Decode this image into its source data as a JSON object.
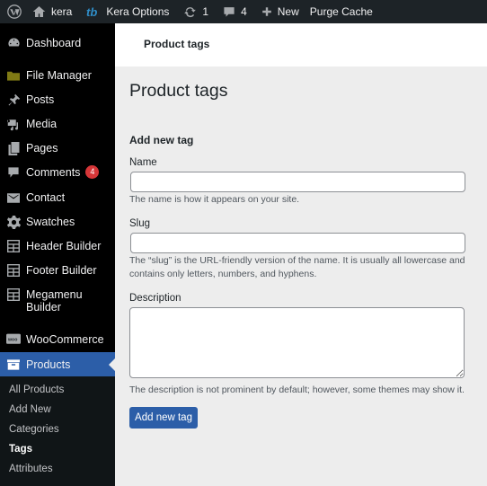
{
  "admin_bar": {
    "site_name": "kera",
    "theme_options": "Kera Options",
    "updates_count": "1",
    "comments_count": "4",
    "new_label": "New",
    "purge_cache": "Purge Cache"
  },
  "sidebar": {
    "items": [
      {
        "label": "Dashboard",
        "icon": "dashboard-icon"
      },
      {
        "label": "File Manager",
        "icon": "folder-icon"
      },
      {
        "label": "Posts",
        "icon": "pin-icon"
      },
      {
        "label": "Media",
        "icon": "media-icon"
      },
      {
        "label": "Pages",
        "icon": "pages-icon"
      },
      {
        "label": "Comments",
        "icon": "comment-icon",
        "badge": "4"
      },
      {
        "label": "Contact",
        "icon": "mail-icon"
      },
      {
        "label": "Swatches",
        "icon": "gear-icon"
      },
      {
        "label": "Header Builder",
        "icon": "builder-icon"
      },
      {
        "label": "Footer Builder",
        "icon": "builder-icon"
      },
      {
        "label": "Megamenu Builder",
        "icon": "builder-icon"
      },
      {
        "label": "WooCommerce",
        "icon": "woo-icon"
      },
      {
        "label": "Products",
        "icon": "archive-icon",
        "active": true
      }
    ],
    "submenu": [
      {
        "label": "All Products"
      },
      {
        "label": "Add New"
      },
      {
        "label": "Categories"
      },
      {
        "label": "Tags",
        "current": true
      },
      {
        "label": "Attributes"
      }
    ]
  },
  "header": {
    "title": "Product tags"
  },
  "main": {
    "page_title": "Product tags",
    "section_title": "Add new tag",
    "name_label": "Name",
    "name_value": "",
    "name_help": "The name is how it appears on your site.",
    "slug_label": "Slug",
    "slug_value": "",
    "slug_help": "The “slug” is the URL-friendly version of the name. It is usually all lowercase and contains only letters, numbers, and hyphens.",
    "description_label": "Description",
    "description_value": "",
    "description_help": "The description is not prominent by default; however, some themes may show it.",
    "submit_label": "Add new tag"
  },
  "colors": {
    "accent": "#2c5ea8",
    "badge": "#d63638",
    "sidebar_bg": "#000000",
    "submenu_bg": "#101517",
    "adminbar_bg": "#1d2327"
  }
}
